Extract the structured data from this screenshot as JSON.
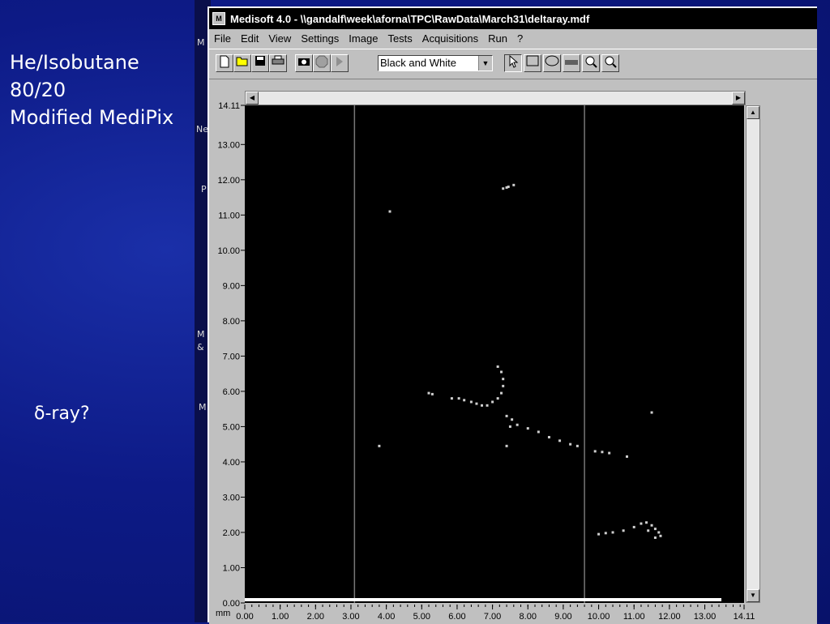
{
  "slide": {
    "annotation_lines": [
      "He/Isobutane",
      "80/20",
      "Modified MediPix"
    ],
    "question": "δ-ray?"
  },
  "background_letters": [
    "M",
    "Ne",
    "P",
    "M",
    "&",
    "M"
  ],
  "window": {
    "title": "Medisoft 4.0 - \\\\gandalf\\week\\aforna\\TPC\\RawData\\March31\\deltaray.mdf",
    "menus": [
      "File",
      "Edit",
      "View",
      "Settings",
      "Image",
      "Tests",
      "Acquisitions",
      "Run",
      "?"
    ],
    "toolbar": {
      "colormap_selected": "Black and White"
    },
    "icons": [
      "new-file-icon",
      "open-folder-icon",
      "save-icon",
      "print-icon",
      "camera-icon",
      "stop-icon",
      "arrow-icon",
      "pointer-icon",
      "rectangle-icon",
      "ellipse-icon",
      "ruler-icon",
      "zoom-in-icon",
      "zoom-out-icon"
    ]
  },
  "chart_data": {
    "type": "scatter",
    "xlabel": "mm",
    "ylabel": "",
    "xlim": [
      0,
      14.11
    ],
    "ylim": [
      0,
      14.11
    ],
    "x_ticks": [
      "0.00",
      "1.00",
      "2.00",
      "3.00",
      "4.00",
      "5.00",
      "6.00",
      "7.00",
      "8.00",
      "9.00",
      "10.00",
      "11.00",
      "12.00",
      "13.00",
      "14.11"
    ],
    "y_ticks": [
      "0.00",
      "1.00",
      "2.00",
      "3.00",
      "4.00",
      "5.00",
      "6.00",
      "7.00",
      "8.00",
      "9.00",
      "10.00",
      "11.00",
      "12.00",
      "13.00",
      "14.11"
    ],
    "background_color": "#000000",
    "point_color": "#cfcfcf",
    "divider_x": [
      3.1,
      9.6
    ],
    "points": [
      [
        7.3,
        11.75
      ],
      [
        7.45,
        11.8
      ],
      [
        7.6,
        11.85
      ],
      [
        7.4,
        11.78
      ],
      [
        4.1,
        11.1
      ],
      [
        7.15,
        6.7
      ],
      [
        7.25,
        6.55
      ],
      [
        7.3,
        6.35
      ],
      [
        7.3,
        6.15
      ],
      [
        7.25,
        5.95
      ],
      [
        7.15,
        5.8
      ],
      [
        7.0,
        5.7
      ],
      [
        6.85,
        5.6
      ],
      [
        6.7,
        5.6
      ],
      [
        6.55,
        5.65
      ],
      [
        6.4,
        5.7
      ],
      [
        6.2,
        5.75
      ],
      [
        6.05,
        5.8
      ],
      [
        5.85,
        5.8
      ],
      [
        5.2,
        5.95
      ],
      [
        5.3,
        5.92
      ],
      [
        7.4,
        5.3
      ],
      [
        7.55,
        5.2
      ],
      [
        7.7,
        5.05
      ],
      [
        7.5,
        5.0
      ],
      [
        8.0,
        4.95
      ],
      [
        8.3,
        4.85
      ],
      [
        8.6,
        4.7
      ],
      [
        8.9,
        4.6
      ],
      [
        9.2,
        4.5
      ],
      [
        9.4,
        4.45
      ],
      [
        9.9,
        4.3
      ],
      [
        10.1,
        4.28
      ],
      [
        10.3,
        4.25
      ],
      [
        10.8,
        4.15
      ],
      [
        7.4,
        4.45
      ],
      [
        3.8,
        4.45
      ],
      [
        11.5,
        5.4
      ],
      [
        10.0,
        1.95
      ],
      [
        10.2,
        1.98
      ],
      [
        10.4,
        2.0
      ],
      [
        10.7,
        2.05
      ],
      [
        11.0,
        2.15
      ],
      [
        11.2,
        2.25
      ],
      [
        11.35,
        2.28
      ],
      [
        11.5,
        2.2
      ],
      [
        11.6,
        2.1
      ],
      [
        11.7,
        2.0
      ],
      [
        11.75,
        1.9
      ],
      [
        11.6,
        1.85
      ],
      [
        11.4,
        2.05
      ]
    ]
  }
}
